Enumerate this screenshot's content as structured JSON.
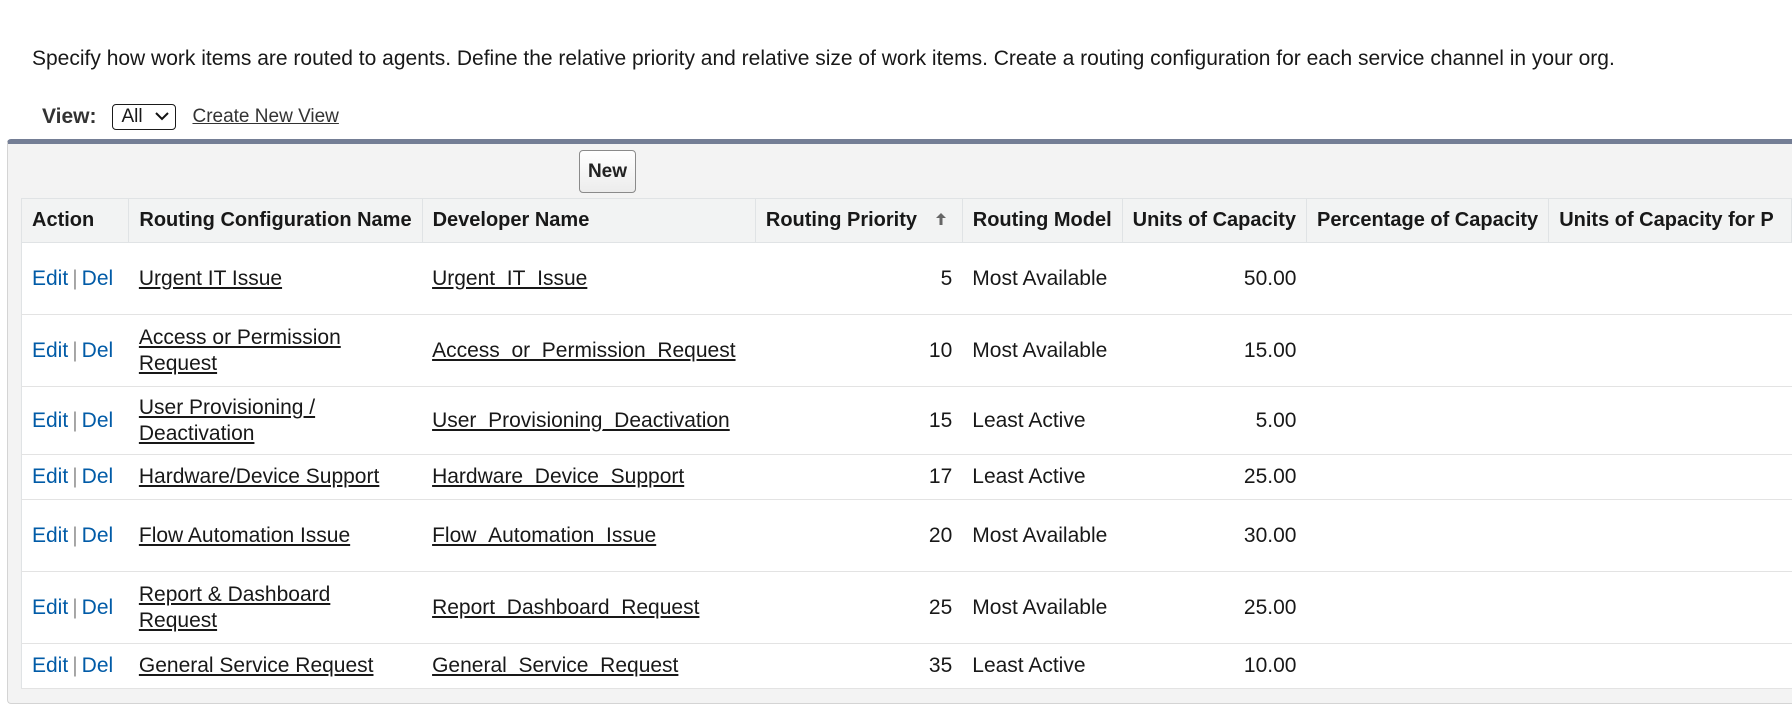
{
  "description": "Specify how work items are routed to agents. Define the relative priority and relative size of work items. Create a routing configuration for each service channel in your org.",
  "view": {
    "label": "View:",
    "selected": "All",
    "create_link": "Create New View"
  },
  "toolbar": {
    "new_label": "New"
  },
  "table": {
    "headers": {
      "action": "Action",
      "name": "Routing Configuration Name",
      "developer_name": "Developer Name",
      "priority": "Routing Priority",
      "model": "Routing Model",
      "units": "Units of Capacity",
      "percentage": "Percentage of Capacity",
      "units_for": "Units of Capacity for P"
    },
    "sort_icon": "arrow-up-icon",
    "edit_label": "Edit",
    "sep": "|",
    "del_label": "Del",
    "rows": [
      {
        "name": "Urgent IT Issue",
        "dev": "Urgent_IT_Issue",
        "priority": "5",
        "model": "Most Available",
        "units": "50.00",
        "percentage": "",
        "units_for": ""
      },
      {
        "name": "Access or Permission Request",
        "dev": "Access_or_Permission_Request",
        "priority": "10",
        "model": "Most Available",
        "units": "15.00",
        "percentage": "",
        "units_for": ""
      },
      {
        "name": "User Provisioning / Deactivation",
        "dev": "User_Provisioning_Deactivation",
        "priority": "15",
        "model": "Least Active",
        "units": "5.00",
        "percentage": "",
        "units_for": ""
      },
      {
        "name": "Hardware/Device Support",
        "dev": "Hardware_Device_Support",
        "priority": "17",
        "model": "Least Active",
        "units": "25.00",
        "percentage": "",
        "units_for": ""
      },
      {
        "name": "Flow Automation Issue",
        "dev": "Flow_Automation_Issue",
        "priority": "20",
        "model": "Most Available",
        "units": "30.00",
        "percentage": "",
        "units_for": ""
      },
      {
        "name": "Report & Dashboard Request",
        "dev": "Report_Dashboard_Request",
        "priority": "25",
        "model": "Most Available",
        "units": "25.00",
        "percentage": "",
        "units_for": ""
      },
      {
        "name": "General Service Request",
        "dev": "General_Service_Request",
        "priority": "35",
        "model": "Least Active",
        "units": "10.00",
        "percentage": "",
        "units_for": ""
      }
    ]
  }
}
